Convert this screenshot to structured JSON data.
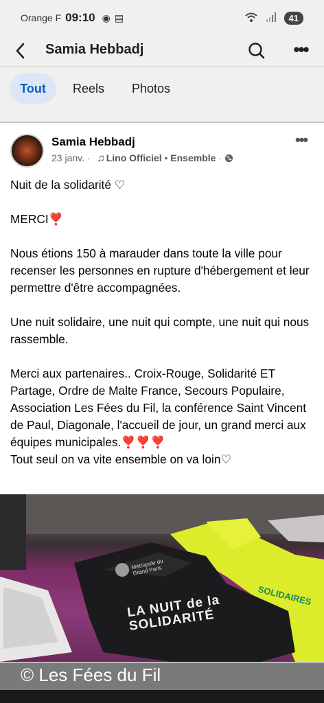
{
  "status_bar": {
    "carrier": "Orange F",
    "time": "09:10",
    "battery": "41"
  },
  "header": {
    "title": "Samia Hebbadj"
  },
  "tabs": [
    "Tout",
    "Reels",
    "Photos"
  ],
  "post": {
    "author": "Samia Hebbadj",
    "date": "23 janv.",
    "music": "Lino Officiel",
    "track": "Ensemble",
    "paragraphs": [
      "Nuit de la solidarité ♡",
      "MERCI❣️",
      "Nous étions 150 à marauder dans toute la ville pour recenser les personnes en rupture d'hébergement et leur permettre d'être accompagnées.",
      "Une nuit solidaire, une nuit qui compte, une nuit qui nous rassemble.",
      "Merci aux partenaires.. Croix-Rouge, Solidarité ET Partage, Ordre de Malte France, Secours Populaire, Association  Les Fées du Fil, la conférence Saint Vincent de Paul, Diagonale, l'accueil de jour, un grand merci aux équipes municipales.❣️❣️❣️",
      "Tout seul on va vite ensemble on va loin♡"
    ],
    "photo": {
      "tshirt_text": "LA NUIT de la SOLIDARITÉ",
      "org_label": "Métropole du Grand Paris",
      "yellow_shirt_text": "SOLIDAIRES"
    }
  },
  "watermark": "© Les Fées du Fil",
  "colors": {
    "accent": "#0a5fc2",
    "active_tab_bg": "#dbe6f6",
    "bar_bg": "#f0f0f0"
  }
}
